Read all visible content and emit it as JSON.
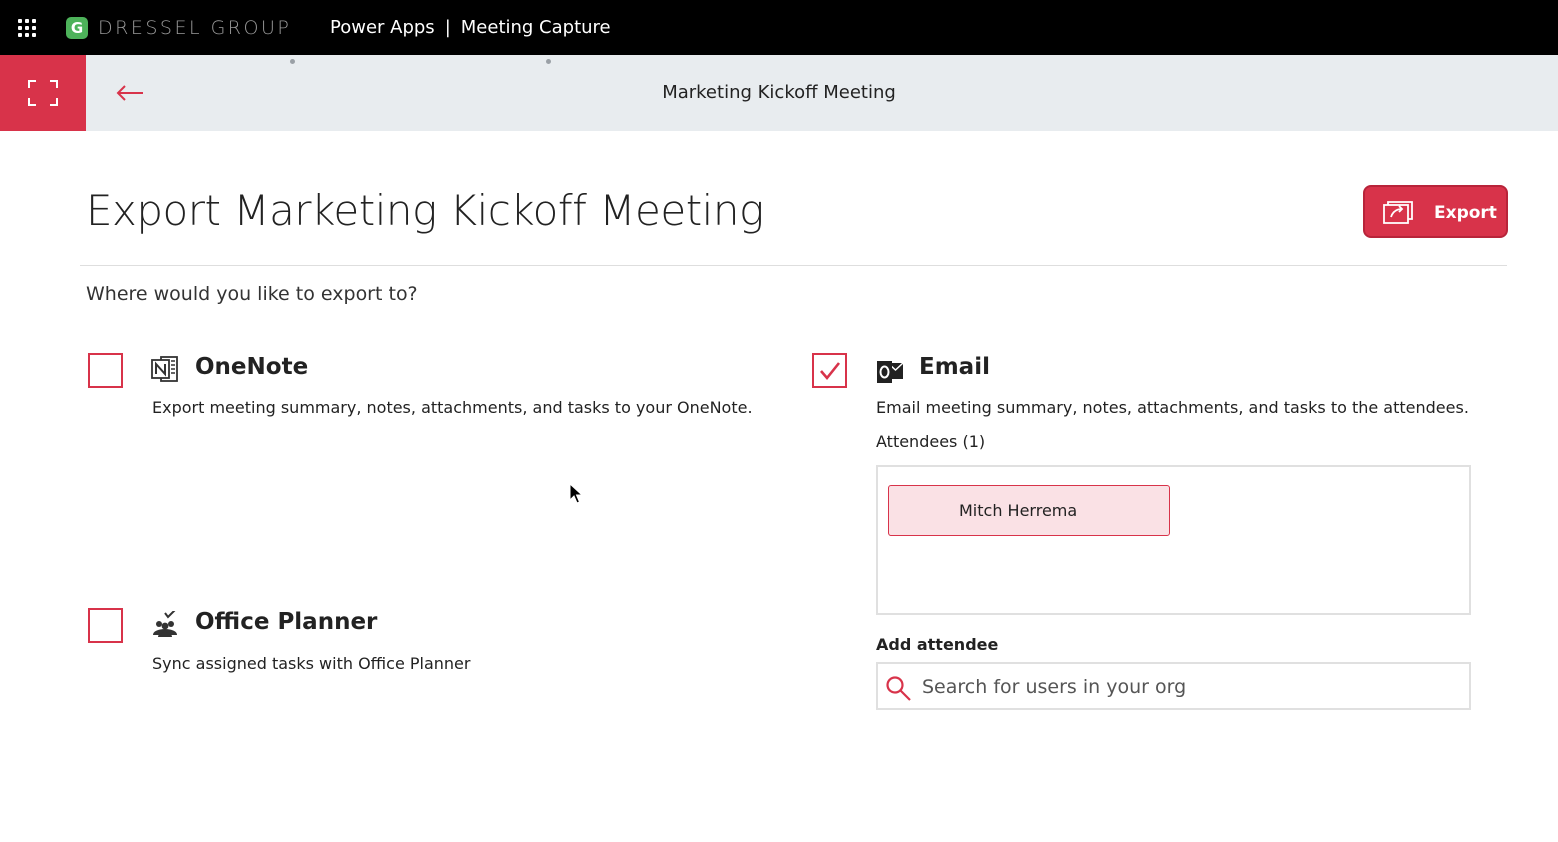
{
  "topbar": {
    "logo_letter": "G",
    "brand": "DRESSEL GROUP",
    "app_name": "Power Apps",
    "separator": "|",
    "app_title": "Meeting Capture"
  },
  "header": {
    "title": "Marketing Kickoff Meeting"
  },
  "page": {
    "title": "Export Marketing Kickoff Meeting",
    "export_label": "Export",
    "question": "Where would you like to export to?"
  },
  "options": {
    "onenote": {
      "title": "OneNote",
      "description": "Export meeting summary, notes, attachments, and tasks to your OneNote.",
      "checked": false,
      "icon": "onenote-icon"
    },
    "email": {
      "title": "Email",
      "description": "Email meeting summary, notes, attachments, and tasks to the attendees.",
      "checked": true,
      "icon": "outlook-icon",
      "attendees_label": "Attendees (1)",
      "attendees": [
        "Mitch Herrema"
      ],
      "add_label": "Add attendee",
      "search_placeholder": "Search for users in your org"
    },
    "planner": {
      "title": "Office Planner",
      "description": "Sync assigned tasks with Office Planner",
      "checked": false,
      "icon": "planner-icon"
    }
  },
  "colors": {
    "accent": "#d8334a",
    "topbar": "#000000",
    "header_bg": "#e8ecef",
    "chip_bg": "#fae1e5"
  }
}
